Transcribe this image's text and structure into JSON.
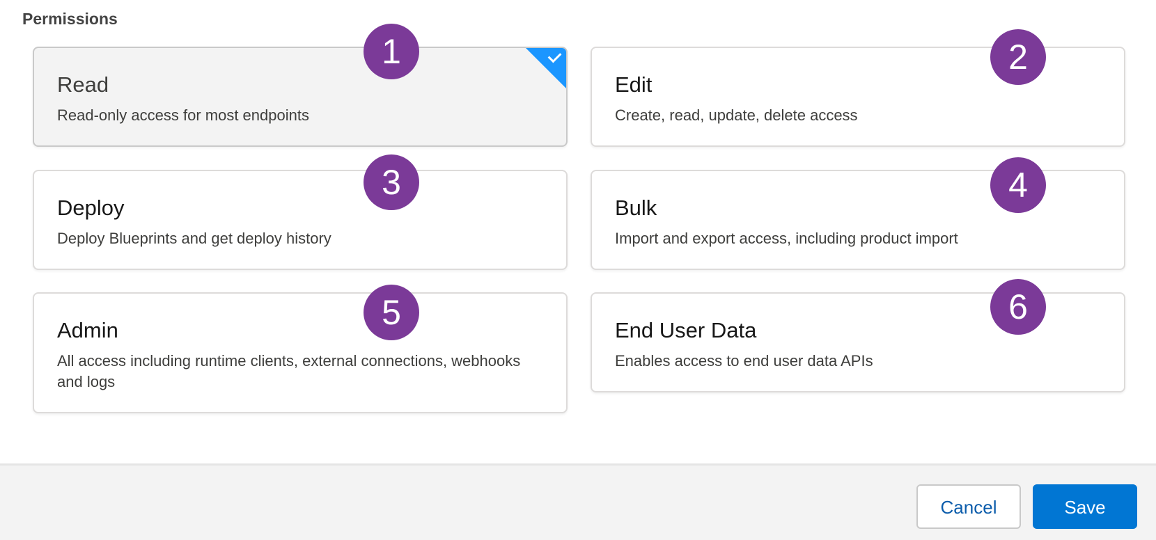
{
  "section": {
    "title": "Permissions"
  },
  "permissions": [
    {
      "number": "1",
      "title": "Read",
      "description": "Read-only access for most endpoints",
      "selected": true
    },
    {
      "number": "2",
      "title": "Edit",
      "description": "Create, read, update, delete access",
      "selected": false
    },
    {
      "number": "3",
      "title": "Deploy",
      "description": "Deploy Blueprints and get deploy history",
      "selected": false
    },
    {
      "number": "4",
      "title": "Bulk",
      "description": "Import and export access, including product import",
      "selected": false
    },
    {
      "number": "5",
      "title": "Admin",
      "description": "All access including runtime clients, external connections, webhooks and logs",
      "selected": false
    },
    {
      "number": "6",
      "title": "End User Data",
      "description": "Enables access to end user data APIs",
      "selected": false
    }
  ],
  "footer": {
    "cancel_label": "Cancel",
    "save_label": "Save"
  },
  "colors": {
    "accent": "#0176d3",
    "selected_corner": "#1b96ff",
    "marker": "#7b3a98"
  },
  "icons": {
    "selected_corner": "check-icon"
  }
}
